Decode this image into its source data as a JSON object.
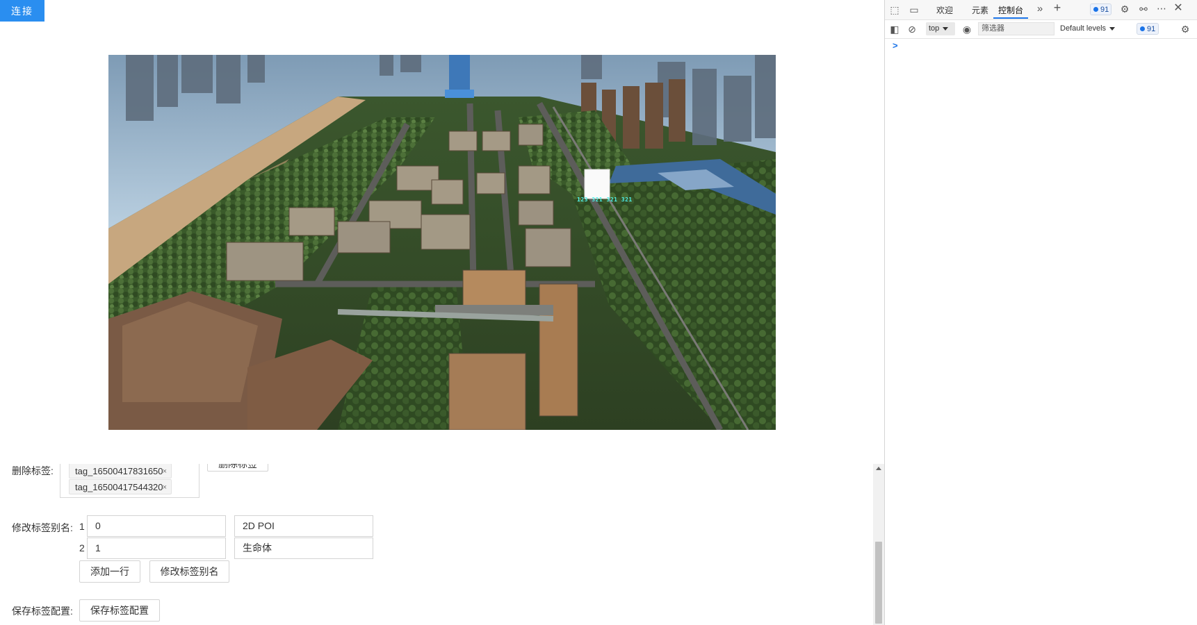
{
  "app": {
    "connect_label": "连接",
    "poi_text": "123 321 321 321"
  },
  "form": {
    "delete_tags": {
      "label": "删除标签:",
      "chips": [
        "tag_16500417831650",
        "tag_16500417544320"
      ],
      "chip_close": "×",
      "button_label": "删除标签"
    },
    "alias": {
      "label": "修改标签别名:",
      "rows": [
        {
          "index": "1",
          "key": "0",
          "value": "2D POI"
        },
        {
          "index": "2",
          "key": "1",
          "value": "生命体"
        }
      ],
      "add_row_label": "添加一行",
      "modify_label": "修改标签别名"
    },
    "save": {
      "label": "保存标签配置:",
      "button_label": "保存标签配置"
    }
  },
  "devtools": {
    "tabs": [
      "欢迎",
      "元素",
      "控制台"
    ],
    "active_tab": "控制台",
    "issues_count": "91",
    "context": "top",
    "filter_placeholder": "筛选器",
    "levels": "Default levels",
    "prompt": ">"
  },
  "colors": {
    "accent": "#2a8ef0",
    "devtools_blue": "#1a73e8",
    "poi_text": "#4ff2ea"
  }
}
